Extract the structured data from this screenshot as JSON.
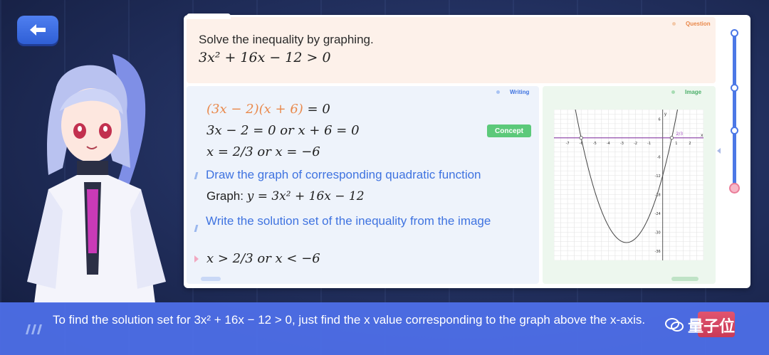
{
  "question": {
    "tag": "Question",
    "title": "Solve the inequality by graphing.",
    "equation": "3x² + 16x − 12 > 0"
  },
  "writing": {
    "tag": "Writing",
    "line1_a": "(3x − 2)",
    "line1_b": "(x + 6)",
    "line1_c": " = 0",
    "line2": "3x − 2 = 0  or  x + 6 = 0",
    "line3": "x = 2/3  or  x = −6",
    "step1": "Draw the graph of corresponding quadratic function",
    "graph_label": "Graph: ",
    "graph_eq": "y = 3x² + 16x − 12",
    "step2": "Write the solution set of the inequality from the image",
    "solution": "x > 2/3  or  x < −6",
    "concept": "Concept"
  },
  "image": {
    "tag": "Image"
  },
  "subtitle": {
    "text": "To find the solution set for 3x² + 16x − 12 > 0, just find the x value corresponding to the graph above the x-axis."
  },
  "watermark": "量子位",
  "chart_data": {
    "type": "line",
    "function": "y = 3x^2 + 16x - 12",
    "x_ticks": [
      -7,
      -6,
      -5,
      -4,
      -3,
      -2,
      -1,
      1,
      2
    ],
    "y_ticks": [
      6,
      -6,
      -12,
      -18,
      -24,
      -30,
      -36
    ],
    "xlim": [
      -8,
      3
    ],
    "ylim": [
      -39,
      9
    ],
    "axis_x_label": "x",
    "axis_y_label": "y",
    "root_label": "2/3",
    "roots": [
      -6,
      0.6667
    ],
    "grid": true
  },
  "colors": {
    "accent_blue": "#3f73e0",
    "orange": "#e9884a",
    "concept_green": "#5cc97a",
    "subtitle_bg": "#4f70eb"
  }
}
